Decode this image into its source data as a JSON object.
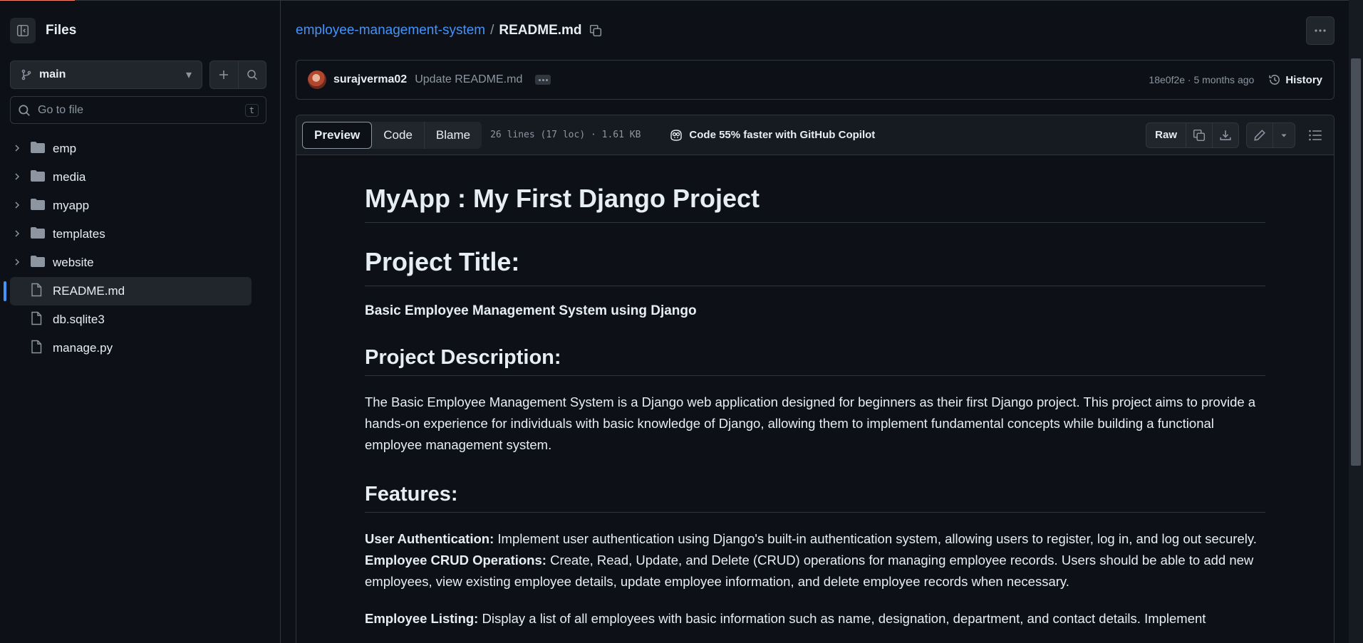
{
  "colors": {
    "background": "#0d1117",
    "accent": "#4493f8",
    "border": "#30363d",
    "muted": "#8d96a0"
  },
  "sidebar": {
    "title": "Files",
    "branch": "main",
    "search_placeholder": "Go to file",
    "search_shortcut": "t",
    "items": [
      {
        "label": "emp",
        "type": "folder"
      },
      {
        "label": "media",
        "type": "folder"
      },
      {
        "label": "myapp",
        "type": "folder"
      },
      {
        "label": "templates",
        "type": "folder"
      },
      {
        "label": "website",
        "type": "folder"
      },
      {
        "label": "README.md",
        "type": "file",
        "active": true
      },
      {
        "label": "db.sqlite3",
        "type": "file"
      },
      {
        "label": "manage.py",
        "type": "file"
      }
    ]
  },
  "breadcrumb": {
    "repo": "employee-management-system",
    "separator": "/",
    "file": "README.md"
  },
  "commit": {
    "author": "surajverma02",
    "message": "Update README.md",
    "meta": "18e0f2e · 5 months ago",
    "history_label": "History"
  },
  "file_header": {
    "tabs": [
      "Preview",
      "Code",
      "Blame"
    ],
    "active_tab": "Preview",
    "meta": "26 lines (17 loc) · 1.61 KB",
    "copilot": "Code 55% faster with GitHub Copilot",
    "raw_label": "Raw"
  },
  "readme": {
    "title": "MyApp : My First Django Project",
    "h_project_title": "Project Title:",
    "project_title": "Basic Employee Management System using Django",
    "h_description": "Project Description:",
    "description": "The Basic Employee Management System is a Django web application designed for beginners as their first Django project. This project aims to provide a hands-on experience for individuals with basic knowledge of Django, allowing them to implement fundamental concepts while building a functional employee management system.",
    "h_features": "Features:",
    "feature1_label": "User Authentication:",
    "feature1_text": " Implement user authentication using Django's built-in authentication system, allowing users to register, log in, and log out securely.",
    "feature2_label": "Employee CRUD Operations:",
    "feature2_text": " Create, Read, Update, and Delete (CRUD) operations for managing employee records. Users should be able to add new employees, view existing employee details, update employee information, and delete employee records when necessary.",
    "feature3_label": "Employee Listing:",
    "feature3_text": " Display a list of all employees with basic information such as name, designation, department, and contact details. Implement"
  }
}
